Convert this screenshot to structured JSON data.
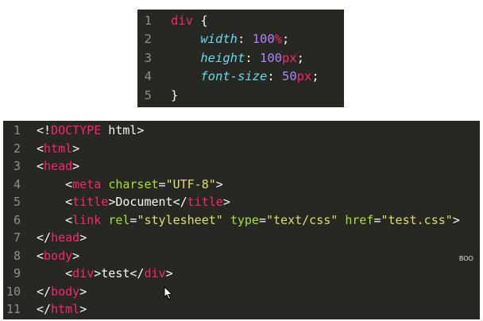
{
  "css_editor": {
    "lines": [
      {
        "num": "1",
        "tokens": [
          {
            "t": "div",
            "c": "tag"
          },
          {
            "t": " {",
            "c": "plain"
          }
        ]
      },
      {
        "num": "2",
        "tokens": [
          {
            "t": "    ",
            "c": "plain"
          },
          {
            "t": "width",
            "c": "prop"
          },
          {
            "t": ": ",
            "c": "plain"
          },
          {
            "t": "100",
            "c": "num"
          },
          {
            "t": "%",
            "c": "unit"
          },
          {
            "t": ";",
            "c": "plain"
          }
        ]
      },
      {
        "num": "3",
        "tokens": [
          {
            "t": "    ",
            "c": "plain"
          },
          {
            "t": "height",
            "c": "prop"
          },
          {
            "t": ": ",
            "c": "plain"
          },
          {
            "t": "100",
            "c": "num"
          },
          {
            "t": "px",
            "c": "unit"
          },
          {
            "t": ";",
            "c": "plain"
          }
        ]
      },
      {
        "num": "4",
        "tokens": [
          {
            "t": "    ",
            "c": "plain"
          },
          {
            "t": "font-size",
            "c": "prop"
          },
          {
            "t": ": ",
            "c": "plain"
          },
          {
            "t": "50",
            "c": "num"
          },
          {
            "t": "px",
            "c": "unit"
          },
          {
            "t": ";",
            "c": "plain"
          }
        ]
      },
      {
        "num": "5",
        "tokens": [
          {
            "t": "}",
            "c": "plain"
          }
        ]
      }
    ]
  },
  "html_editor": {
    "lines": [
      {
        "num": "1",
        "tokens": [
          {
            "t": "<!",
            "c": "plain"
          },
          {
            "t": "DOCTYPE",
            "c": "doctype"
          },
          {
            "t": " html>",
            "c": "plain"
          }
        ]
      },
      {
        "num": "2",
        "tokens": [
          {
            "t": "<",
            "c": "plain"
          },
          {
            "t": "html",
            "c": "tag"
          },
          {
            "t": ">",
            "c": "plain"
          }
        ]
      },
      {
        "num": "3",
        "tokens": [
          {
            "t": "<",
            "c": "plain"
          },
          {
            "t": "head",
            "c": "tag"
          },
          {
            "t": ">",
            "c": "plain"
          }
        ]
      },
      {
        "num": "4",
        "tokens": [
          {
            "t": "    <",
            "c": "plain"
          },
          {
            "t": "meta",
            "c": "tag"
          },
          {
            "t": " ",
            "c": "plain"
          },
          {
            "t": "charset",
            "c": "attr"
          },
          {
            "t": "=",
            "c": "plain"
          },
          {
            "t": "\"UTF-8\"",
            "c": "str"
          },
          {
            "t": ">",
            "c": "plain"
          }
        ]
      },
      {
        "num": "5",
        "tokens": [
          {
            "t": "    <",
            "c": "plain"
          },
          {
            "t": "title",
            "c": "tag"
          },
          {
            "t": ">Document</",
            "c": "plain"
          },
          {
            "t": "title",
            "c": "tag"
          },
          {
            "t": ">",
            "c": "plain"
          }
        ]
      },
      {
        "num": "6",
        "tokens": [
          {
            "t": "    <",
            "c": "plain"
          },
          {
            "t": "link",
            "c": "tag"
          },
          {
            "t": " ",
            "c": "plain"
          },
          {
            "t": "rel",
            "c": "attr"
          },
          {
            "t": "=",
            "c": "plain"
          },
          {
            "t": "\"stylesheet\"",
            "c": "str"
          },
          {
            "t": " ",
            "c": "plain"
          },
          {
            "t": "type",
            "c": "attr"
          },
          {
            "t": "=",
            "c": "plain"
          },
          {
            "t": "\"text/css\"",
            "c": "str"
          },
          {
            "t": " ",
            "c": "plain"
          },
          {
            "t": "href",
            "c": "attr"
          },
          {
            "t": "=",
            "c": "plain"
          },
          {
            "t": "\"test.css\"",
            "c": "str"
          },
          {
            "t": ">",
            "c": "plain"
          }
        ]
      },
      {
        "num": "7",
        "tokens": [
          {
            "t": "</",
            "c": "plain"
          },
          {
            "t": "head",
            "c": "tag"
          },
          {
            "t": ">",
            "c": "plain"
          }
        ]
      },
      {
        "num": "8",
        "tokens": [
          {
            "t": "<",
            "c": "plain"
          },
          {
            "t": "body",
            "c": "tag"
          },
          {
            "t": ">",
            "c": "plain"
          }
        ]
      },
      {
        "num": "9",
        "tokens": [
          {
            "t": "    <",
            "c": "plain"
          },
          {
            "t": "div",
            "c": "tag"
          },
          {
            "t": ">test</",
            "c": "plain"
          },
          {
            "t": "div",
            "c": "tag"
          },
          {
            "t": ">",
            "c": "plain"
          }
        ]
      },
      {
        "num": "10",
        "tokens": [
          {
            "t": "</",
            "c": "plain"
          },
          {
            "t": "body",
            "c": "tag"
          },
          {
            "t": ">",
            "c": "plain"
          }
        ]
      },
      {
        "num": "11",
        "tokens": [
          {
            "t": "</",
            "c": "plain"
          },
          {
            "t": "html",
            "c": "tag"
          },
          {
            "t": ">",
            "c": "plain"
          }
        ]
      }
    ]
  },
  "watermark": "BOO",
  "cursor_icon": "mouse-pointer-icon",
  "colors": {
    "editor_bg": "#272822",
    "line_number": "#8f908a",
    "plain": "#f8f8f2",
    "tag": "#f92672",
    "attr": "#a6e22e",
    "string": "#e6db74",
    "property": "#66d9ef",
    "number": "#ae81ff"
  }
}
